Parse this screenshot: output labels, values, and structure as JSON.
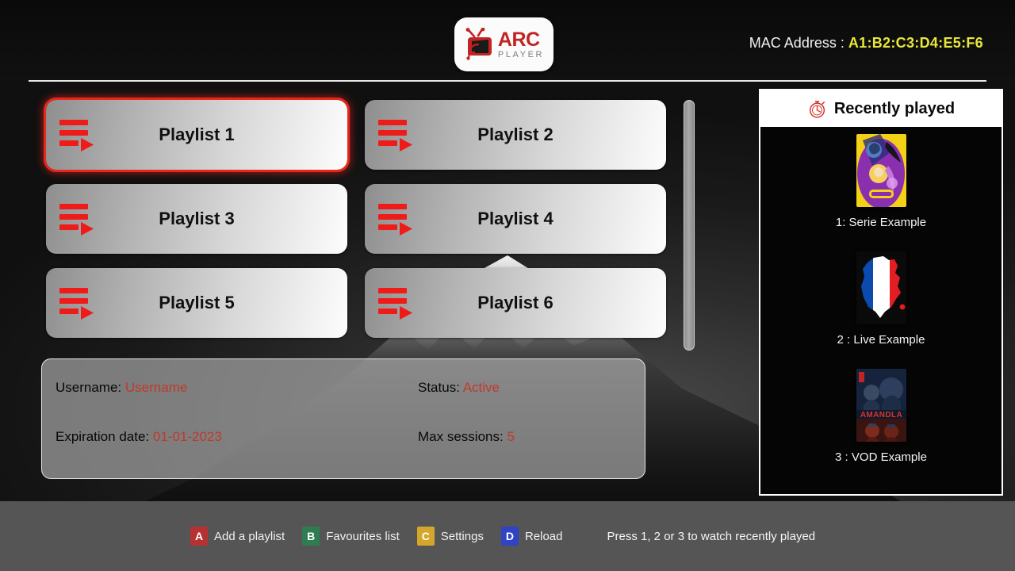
{
  "app": {
    "brand_primary": "ARC",
    "brand_secondary": "PLAYER",
    "logo_icon": "tv-antenna-wifi-icon",
    "accent_red": "#e8261c",
    "accent_yellow": "#e8e83a",
    "value_color": "#c0392b",
    "footer_bg": "#555555"
  },
  "header": {
    "mac_label": "MAC Address :",
    "mac_value": "A1:B2:C3:D4:E5:F6"
  },
  "playlists": {
    "selected_index": 0,
    "items": [
      {
        "label": "Playlist 1",
        "icon": "playlist-play-icon"
      },
      {
        "label": "Playlist 2",
        "icon": "playlist-play-icon"
      },
      {
        "label": "Playlist 3",
        "icon": "playlist-play-icon"
      },
      {
        "label": "Playlist 4",
        "icon": "playlist-play-icon"
      },
      {
        "label": "Playlist 5",
        "icon": "playlist-play-icon"
      },
      {
        "label": "Playlist 6",
        "icon": "playlist-play-icon"
      }
    ]
  },
  "account": {
    "rows": [
      {
        "left_key": "Username:",
        "left_value": "Username",
        "right_key": "Status:",
        "right_value": "Active"
      },
      {
        "left_key": "Expiration date:",
        "left_value": "01-01-2023",
        "right_key": "Max sessions:",
        "right_value": "5"
      }
    ]
  },
  "recently_played": {
    "title": "Recently played",
    "title_icon": "stopwatch-icon",
    "items": [
      {
        "label": "1: Serie Example",
        "thumb": "tangled-poster-thumbnail"
      },
      {
        "label": "2 : Live Example",
        "thumb": "france-flag-map-thumbnail"
      },
      {
        "label": "3 : VOD Example",
        "thumb": "amandla-poster-thumbnail"
      }
    ]
  },
  "footer": {
    "keys": [
      {
        "key": "A",
        "label": "Add a playlist",
        "color": "#b63232"
      },
      {
        "key": "B",
        "label": "Favourites list",
        "color": "#2e7d52"
      },
      {
        "key": "C",
        "label": "Settings",
        "color": "#d4a72c"
      },
      {
        "key": "D",
        "label": "Reload",
        "color": "#2f44c4"
      }
    ],
    "hint": "Press 1, 2 or 3 to watch recently played"
  }
}
